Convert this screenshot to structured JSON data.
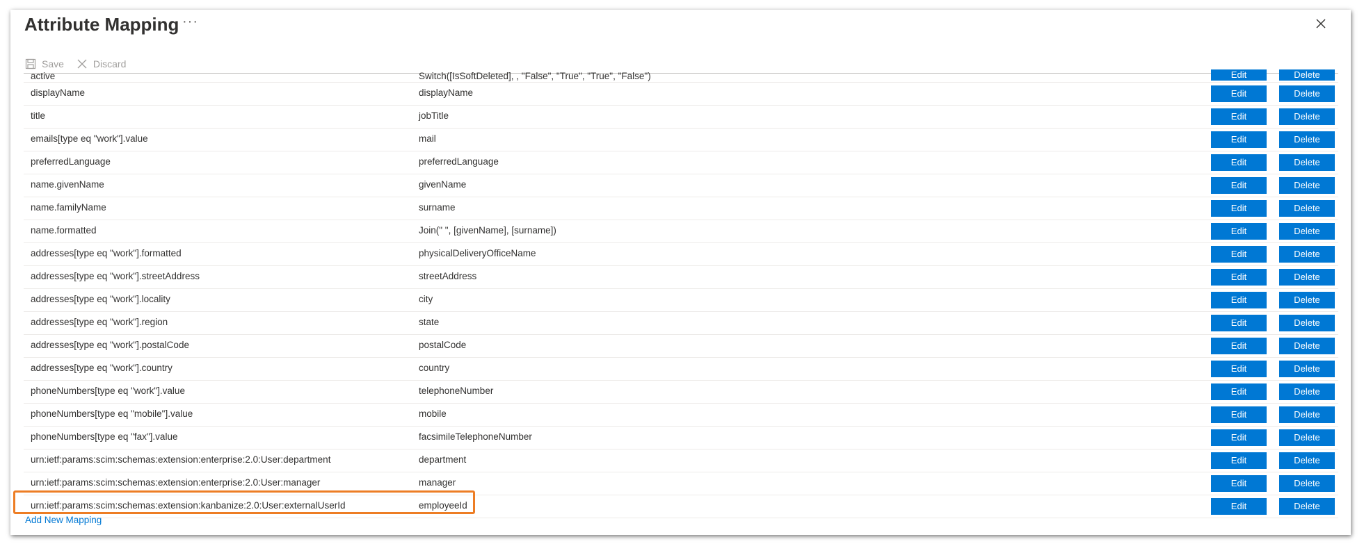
{
  "title": "Attribute Mapping",
  "more_label": "···",
  "close_icon": "close-icon",
  "toolbar": {
    "save_label": "Save",
    "discard_label": "Discard"
  },
  "colors": {
    "accent": "#0078d4",
    "highlight": "#ed7d24"
  },
  "buttons": {
    "edit_label": "Edit",
    "delete_label": "Delete"
  },
  "mappings": [
    {
      "target": "active",
      "source": "Switch([IsSoftDeleted], , \"False\", \"True\", \"True\", \"False\")"
    },
    {
      "target": "displayName",
      "source": "displayName"
    },
    {
      "target": "title",
      "source": "jobTitle"
    },
    {
      "target": "emails[type eq \"work\"].value",
      "source": "mail"
    },
    {
      "target": "preferredLanguage",
      "source": "preferredLanguage"
    },
    {
      "target": "name.givenName",
      "source": "givenName"
    },
    {
      "target": "name.familyName",
      "source": "surname"
    },
    {
      "target": "name.formatted",
      "source": "Join(\" \", [givenName], [surname])"
    },
    {
      "target": "addresses[type eq \"work\"].formatted",
      "source": "physicalDeliveryOfficeName"
    },
    {
      "target": "addresses[type eq \"work\"].streetAddress",
      "source": "streetAddress"
    },
    {
      "target": "addresses[type eq \"work\"].locality",
      "source": "city"
    },
    {
      "target": "addresses[type eq \"work\"].region",
      "source": "state"
    },
    {
      "target": "addresses[type eq \"work\"].postalCode",
      "source": "postalCode"
    },
    {
      "target": "addresses[type eq \"work\"].country",
      "source": "country"
    },
    {
      "target": "phoneNumbers[type eq \"work\"].value",
      "source": "telephoneNumber"
    },
    {
      "target": "phoneNumbers[type eq \"mobile\"].value",
      "source": "mobile"
    },
    {
      "target": "phoneNumbers[type eq \"fax\"].value",
      "source": "facsimileTelephoneNumber"
    },
    {
      "target": "urn:ietf:params:scim:schemas:extension:enterprise:2.0:User:department",
      "source": "department"
    },
    {
      "target": "urn:ietf:params:scim:schemas:extension:enterprise:2.0:User:manager",
      "source": "manager"
    },
    {
      "target": "urn:ietf:params:scim:schemas:extension:kanbanize:2.0:User:externalUserId",
      "source": "employeeId"
    }
  ],
  "add_mapping_label": "Add New Mapping"
}
